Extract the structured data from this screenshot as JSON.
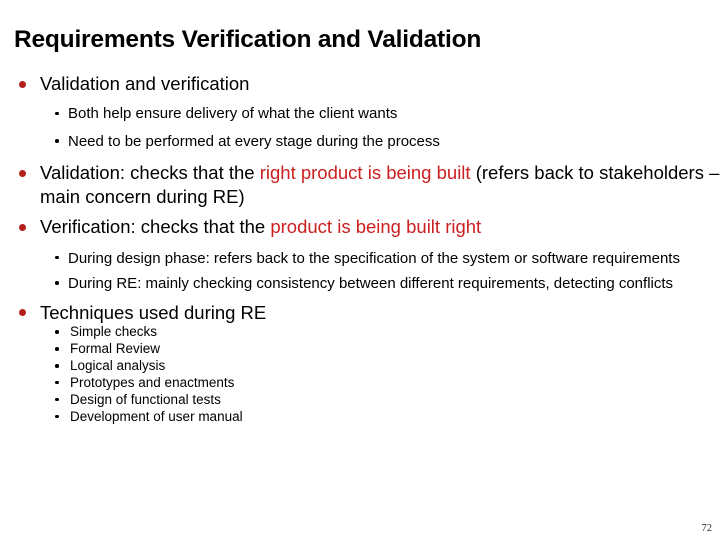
{
  "slide": {
    "title": "Requirements Verification and Validation",
    "page_number": "72",
    "accent_bullet_color": "#b51f1a",
    "highlight_color": "#cc2020",
    "background_color": "#ffffff",
    "text_color": "#000000"
  },
  "content": {
    "b1": {
      "text": "Validation and verification",
      "sub": [
        "Both help ensure delivery of what the client wants",
        "Need to be performed at every stage during the process"
      ]
    },
    "b2": {
      "lead": "Validation: checks that the ",
      "highlight": "right product is being built",
      "tail": " (refers back to stakeholders – main concern during RE)"
    },
    "b3": {
      "lead": "Verification: checks that the ",
      "highlight": "product is being built right",
      "tail": ""
    },
    "b3_sub": [
      "During design phase: refers back to the specification of the system or software requirements",
      "During RE: mainly checking consistency between different requirements, detecting conflicts"
    ],
    "b4": {
      "text": "Techniques used during RE",
      "items": [
        "Simple checks",
        "Formal Review",
        "Logical analysis",
        "Prototypes and enactments",
        "Design of functional tests",
        "Development of user manual"
      ]
    }
  }
}
